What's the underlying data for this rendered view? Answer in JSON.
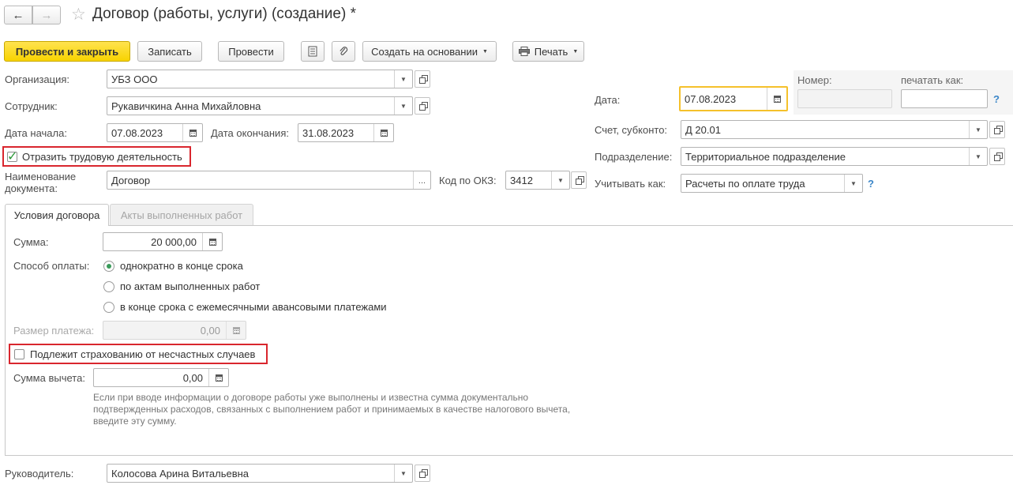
{
  "window": {
    "title": "Договор (работы, услуги) (создание) *",
    "back_arrow": "←",
    "forward_arrow": "→",
    "star_icon": "☆"
  },
  "toolbar": {
    "post_close": "Провести и закрыть",
    "save": "Записать",
    "post": "Провести",
    "create_based": "Создать на основании",
    "print": "Печать"
  },
  "form": {
    "organization_label": "Организация:",
    "organization_value": "УБЗ ООО",
    "employee_label": "Сотрудник:",
    "employee_value": "Рукавичкина Анна Михайловна",
    "start_date_label": "Дата начала:",
    "start_date_value": "07.08.2023",
    "end_date_label": "Дата окончания:",
    "end_date_value": "31.08.2023",
    "reflect_work_label": "Отразить трудовую деятельность",
    "reflect_work_checked": true,
    "doc_name_label_1": "Наименование",
    "doc_name_label_2": "документа:",
    "doc_name_value": "Договор",
    "okz_label": "Код по ОКЗ:",
    "okz_value": "3412",
    "date_label": "Дата:",
    "date_value": "07.08.2023",
    "number_label": "Номер:",
    "number_value": "",
    "print_as_label": "печатать как:",
    "print_as_value": "",
    "account_label": "Счет, субконто:",
    "account_value": "Д 20.01",
    "department_label": "Подразделение:",
    "department_value": "Территориальное подразделение",
    "account_as_label": "Учитывать как:",
    "account_as_value": "Расчеты по оплате труда",
    "help_mark": "?"
  },
  "tabs": [
    {
      "label": "Условия договора",
      "active": true
    },
    {
      "label": "Акты выполненных работ",
      "active": false
    }
  ],
  "terms": {
    "sum_label": "Сумма:",
    "sum_value": "20 000,00",
    "payment_label": "Способ оплаты:",
    "payment_options": [
      {
        "label": "однократно в конце срока",
        "selected": true
      },
      {
        "label": "по актам выполненных работ",
        "selected": false
      },
      {
        "label": "в конце срока с ежемесячными авансовыми платежами",
        "selected": false
      }
    ],
    "payment_size_label": "Размер платежа:",
    "payment_size_value": "0,00",
    "insurance_label": "Подлежит страхованию от несчастных случаев",
    "insurance_checked": false,
    "deduction_label": "Сумма вычета:",
    "deduction_value": "0,00",
    "hint_line_1": "Если при вводе информации о договоре работы уже выполнены и известна сумма документально",
    "hint_line_2": "подтвержденных расходов, связанных с выполнением работ и принимаемых в качестве налогового вычета,",
    "hint_line_3": "введите эту сумму."
  },
  "footer": {
    "manager_label": "Руководитель:",
    "manager_value": "Колосова Арина Витальевна"
  },
  "colors": {
    "primary_button": "#f8d300",
    "highlight_border": "#d9262e",
    "date_focus_border": "#f5c12b",
    "help": "#3b86c8"
  }
}
